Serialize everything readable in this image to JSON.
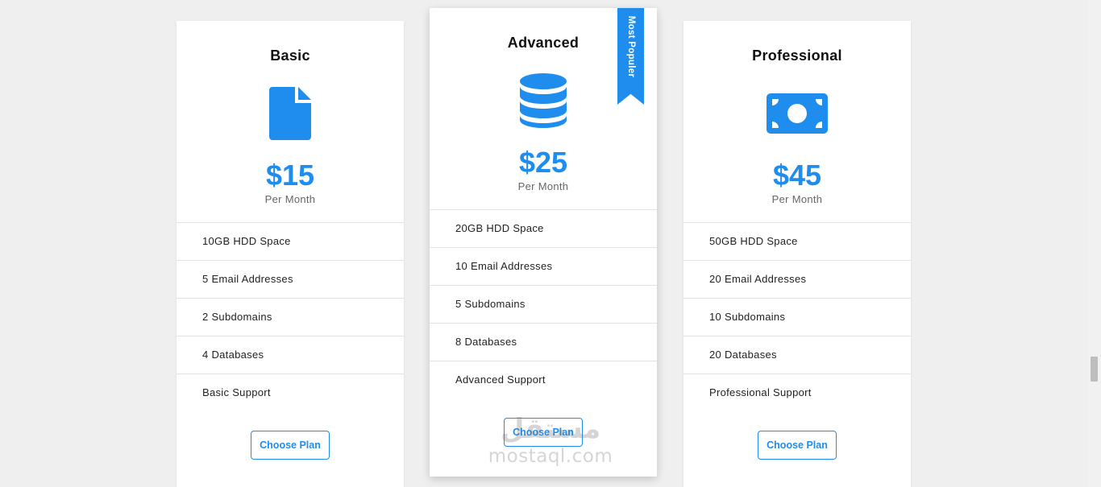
{
  "accent_color": "#1f8ded",
  "plans": [
    {
      "title": "Basic",
      "icon": "file-icon",
      "price": "$15",
      "period": "Per Month",
      "features": [
        "10GB HDD Space",
        "5 Email Addresses",
        "2 Subdomains",
        "4 Databases",
        "Basic Support"
      ],
      "button_label": "Choose Plan"
    },
    {
      "title": "Advanced",
      "icon": "database-icon",
      "price": "$25",
      "period": "Per Month",
      "ribbon": "Most Populer",
      "features": [
        "20GB HDD Space",
        "10 Email Addresses",
        "5 Subdomains",
        "8 Databases",
        "Advanced Support"
      ],
      "button_label": "Choose Plan"
    },
    {
      "title": "Professional",
      "icon": "money-bill-icon",
      "price": "$45",
      "period": "Per Month",
      "features": [
        "50GB HDD Space",
        "20 Email Addresses",
        "10 Subdomains",
        "20 Databases",
        "Professional Support"
      ],
      "button_label": "Choose Plan"
    }
  ],
  "watermark": {
    "arabic": "مستقل",
    "latin": "mostaql.com"
  }
}
